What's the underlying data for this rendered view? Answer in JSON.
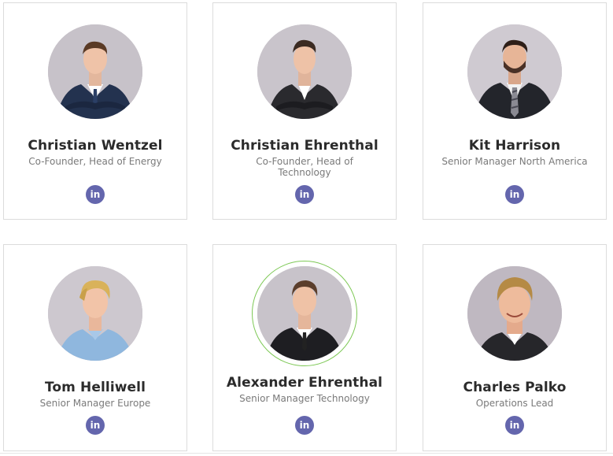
{
  "team": [
    {
      "name": "Christian Wentzel",
      "role": "Co-Founder, Head of Energy",
      "linkedin_icon": "in"
    },
    {
      "name": "Christian Ehrenthal",
      "role": "Co-Founder, Head of Technology",
      "linkedin_icon": "in"
    },
    {
      "name": "Kit Harrison",
      "role": "Senior Manager North America",
      "linkedin_icon": "in"
    },
    {
      "name": "Tom Helliwell",
      "role": "Senior Manager Europe",
      "linkedin_icon": "in"
    },
    {
      "name": "Alexander Ehrenthal",
      "role": "Senior Manager Technology",
      "linkedin_icon": "in"
    },
    {
      "name": "Charles Palko",
      "role": "Operations Lead",
      "linkedin_icon": "in"
    }
  ],
  "colors": {
    "linkedin_button": "#6466ad",
    "hover_ring": "#7dc855",
    "card_border": "#dcdcdc",
    "name_text": "#2b2b2b",
    "role_text": "#7a7a7a"
  }
}
